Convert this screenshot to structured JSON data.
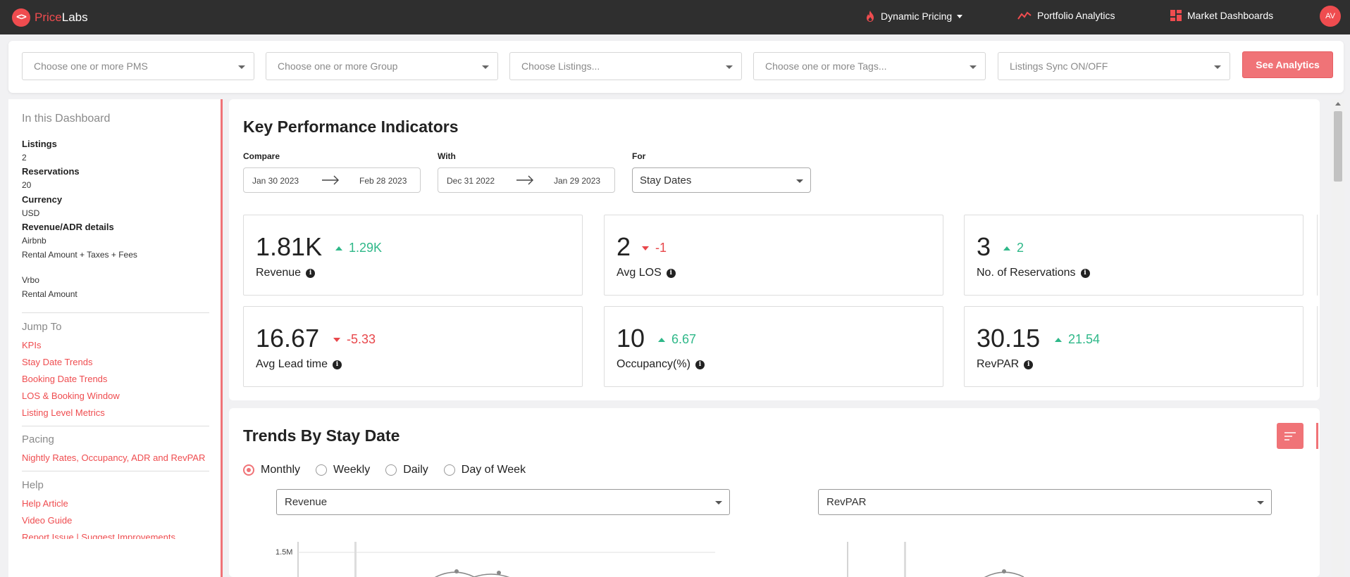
{
  "brand": {
    "part1": "Price",
    "part2": "Labs",
    "mark": "<>",
    "color": "#ef4c4f"
  },
  "nav": {
    "dynamic_pricing": "Dynamic Pricing",
    "portfolio_analytics": "Portfolio Analytics",
    "market_dashboards": "Market Dashboards",
    "avatar": "AV"
  },
  "filters": {
    "pms_placeholder": "Choose one or more PMS",
    "group_placeholder": "Choose one or more Group",
    "listings_placeholder": "Choose Listings...",
    "tags_placeholder": "Choose one or more Tags...",
    "sync_placeholder": "Listings Sync ON/OFF",
    "see_analytics": "See Analytics"
  },
  "sidebar": {
    "heading": "In this Dashboard",
    "listings_label": "Listings",
    "listings_value": "2",
    "reservations_label": "Reservations",
    "reservations_value": "20",
    "currency_label": "Currency",
    "currency_value": "USD",
    "revenue_label": "Revenue/ADR details",
    "airbnb_name": "Airbnb",
    "airbnb_desc": "Rental Amount + Taxes + Fees",
    "vrbo_name": "Vrbo",
    "vrbo_desc": "Rental Amount",
    "jump_heading": "Jump To",
    "jump_links": [
      "KPIs",
      "Stay Date Trends",
      "Booking Date Trends",
      "LOS & Booking Window",
      "Listing Level Metrics"
    ],
    "pacing_heading": "Pacing",
    "pacing_link": "Nightly Rates, Occupancy, ADR and RevPAR",
    "help_heading": "Help",
    "help_links": [
      "Help Article",
      "Video Guide",
      "Report Issue | Suggest Improvements"
    ]
  },
  "kpi": {
    "title": "Key Performance Indicators",
    "compare_label": "Compare",
    "compare_start": "Jan 30 2023",
    "compare_end": "Feb 28 2023",
    "with_label": "With",
    "with_start": "Dec 31 2022",
    "with_end": "Jan 29 2023",
    "for_label": "For",
    "for_value": "Stay Dates",
    "cards": [
      {
        "value": "1.81K",
        "delta": "1.29K",
        "direction": "up",
        "label": "Revenue"
      },
      {
        "value": "2",
        "delta": "-1",
        "direction": "down",
        "label": "Avg LOS"
      },
      {
        "value": "3",
        "delta": "2",
        "direction": "up",
        "label": "No. of Reservations"
      },
      {
        "value": "16.67",
        "delta": "-5.33",
        "direction": "down",
        "label": "Avg Lead time"
      },
      {
        "value": "10",
        "delta": "6.67",
        "direction": "up",
        "label": "Occupancy(%)"
      },
      {
        "value": "30.15",
        "delta": "21.54",
        "direction": "up",
        "label": "RevPAR"
      }
    ]
  },
  "trends": {
    "title": "Trends By Stay Date",
    "radios": [
      {
        "label": "Monthly",
        "selected": true
      },
      {
        "label": "Weekly",
        "selected": false
      },
      {
        "label": "Daily",
        "selected": false
      },
      {
        "label": "Day of Week",
        "selected": false
      }
    ],
    "left_metric": "Revenue",
    "right_metric": "RevPAR",
    "left_ytick": "1.5M"
  },
  "colors": {
    "accent": "#f07377",
    "up": "#2fb889",
    "down": "#e8474b",
    "topbar": "#2f2f2f"
  }
}
